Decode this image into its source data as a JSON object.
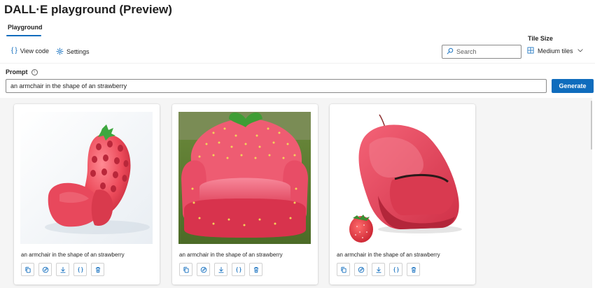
{
  "header": {
    "title": "DALL·E playground (Preview)"
  },
  "tabs": [
    {
      "label": "Playground",
      "selected": true
    }
  ],
  "toolbar": {
    "view_code_label": "View code",
    "settings_label": "Settings"
  },
  "tile_size": {
    "label": "Tile Size",
    "selected": "Medium tiles"
  },
  "search": {
    "placeholder": "Search",
    "value": ""
  },
  "prompt": {
    "label": "Prompt",
    "value": "an armchair in the shape of an strawberry",
    "generate_label": "Generate"
  },
  "results": [
    {
      "caption": "an armchair in the shape of an strawberry"
    },
    {
      "caption": "an armchair in the shape of an strawberry"
    },
    {
      "caption": "an armchair in the shape of an strawberry"
    }
  ],
  "icons": {
    "card_actions": [
      "copy-icon",
      "edit-image-icon",
      "download-icon",
      "code-icon",
      "delete-icon"
    ]
  },
  "colors": {
    "accent": "#0f6cbd",
    "gallery_bg": "#f5f5f5",
    "strawberry": "#e8485c"
  }
}
